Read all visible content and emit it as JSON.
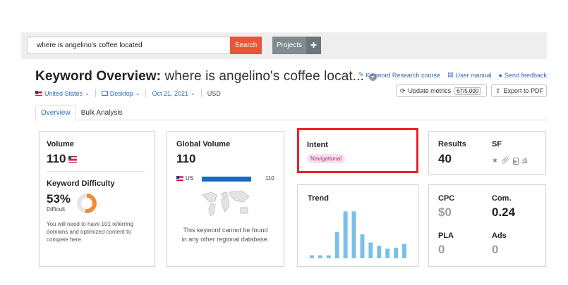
{
  "search": {
    "value": "where is angelino's coffee located",
    "button": "Search"
  },
  "projects": {
    "label": "Projects",
    "plus": "+"
  },
  "header": {
    "title_prefix": "Keyword Overview:",
    "title_keyword": "where is angelino's coffee locat...",
    "info": "+"
  },
  "links": {
    "course": "Keyword Research course",
    "manual": "User manual",
    "feedback": "Send feedback"
  },
  "filters": {
    "country": "United States",
    "device": "Desktop",
    "date": "Oct 21, 2021",
    "currency": "USD"
  },
  "actions": {
    "update": "Update metrics",
    "update_count": "67/5,000",
    "export": "Export to PDF"
  },
  "tabs": [
    "Overview",
    "Bulk Analysis"
  ],
  "volume": {
    "label": "Volume",
    "value": "110",
    "kd_label": "Keyword Difficulty",
    "kd_value": "53%",
    "kd_text": "Difficult",
    "kd_percent": 53,
    "kd_note_lines": [
      "You will need to have 101 referring",
      "domains and optimized content to",
      "compete here."
    ]
  },
  "global_volume": {
    "label": "Global Volume",
    "value": "110",
    "country": "US",
    "country_value": "110",
    "bar_fraction": 1.0,
    "note_lines": [
      "This keyword cannot be found",
      "in any other regional database."
    ]
  },
  "intent": {
    "label": "Intent",
    "badge": "Navigational"
  },
  "trend": {
    "label": "Trend",
    "values": [
      0.06,
      0.06,
      0.06,
      0.55,
      0.98,
      0.98,
      0.5,
      0.33,
      0.26,
      0.2,
      0.22,
      0.3
    ],
    "bar_color": "#7cbfe8"
  },
  "results": {
    "label": "Results",
    "value": "40",
    "sf_label": "SF",
    "sf_more": "+5"
  },
  "cpc": {
    "cpc_label": "CPC",
    "cpc_value": "$0",
    "com_label": "Com.",
    "com_value": "0.24",
    "pla_label": "PLA",
    "pla_value": "0",
    "ads_label": "Ads",
    "ads_value": "0"
  }
}
